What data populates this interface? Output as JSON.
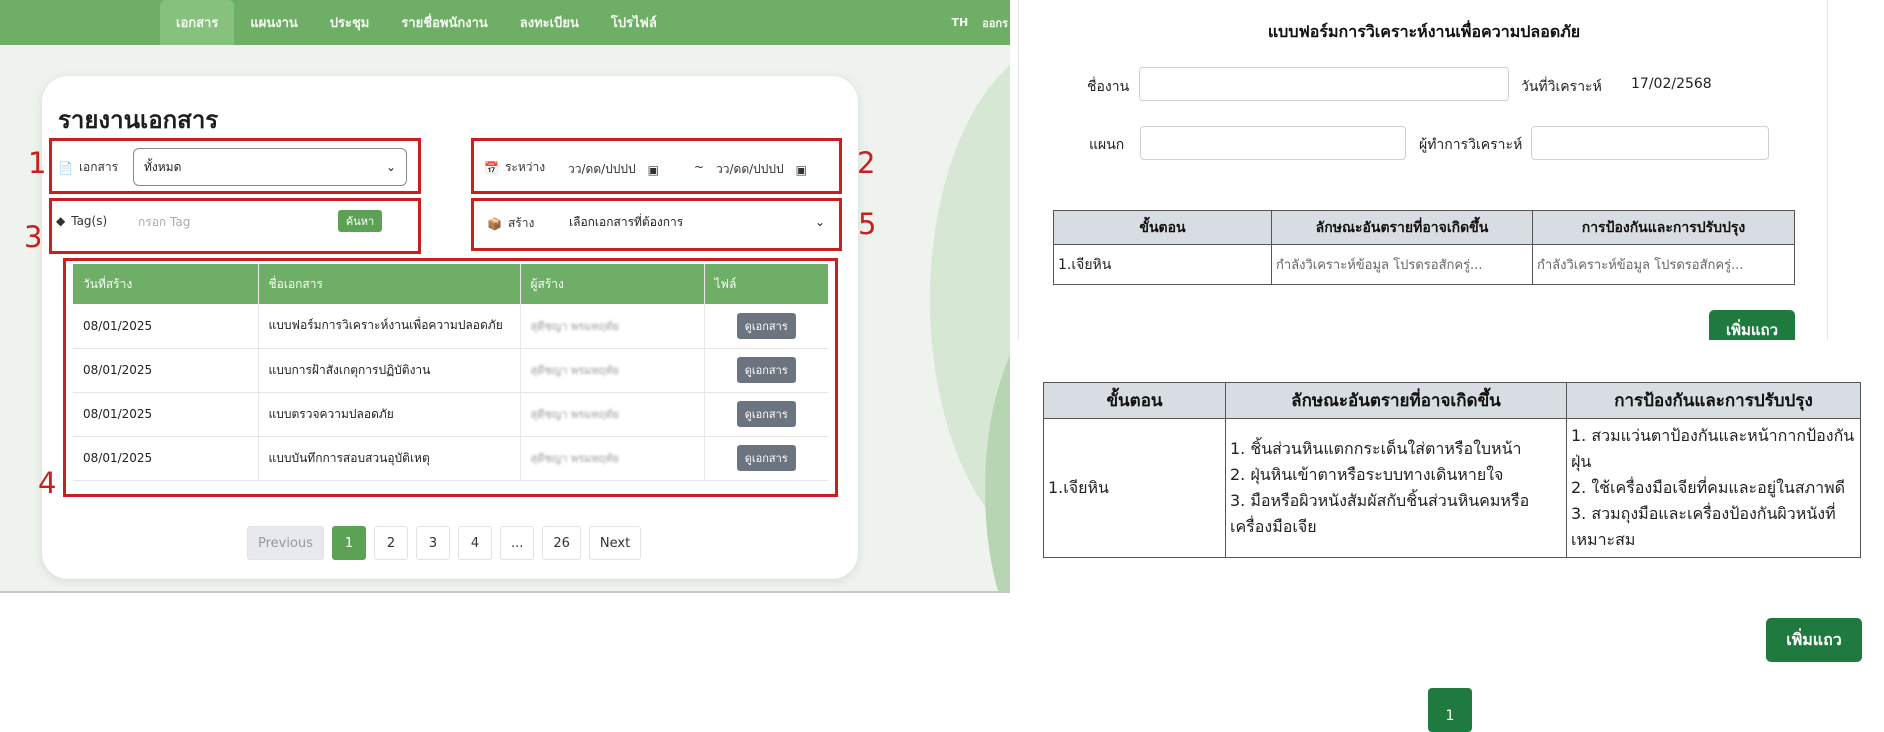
{
  "nav": {
    "tabs": [
      "เอกสาร",
      "แผนงาน",
      "ประชุม",
      "รายชื่อพนักงาน",
      "ลงทะเบียน",
      "โปรไฟล์"
    ],
    "lang": "TH",
    "logout": "ออกร"
  },
  "report": {
    "title": "รายงานเอกสาร",
    "doc_label": "เอกสาร",
    "doc_select": "ทั้งหมด",
    "tag_label": "Tag(s)",
    "tag_placeholder": "กรอก Tag",
    "search_label": "ค้นหา",
    "between_label": "ระหว่าง",
    "date_from": "วว/ดด/ปปปป",
    "date_sep": "~",
    "date_to": "วว/ดด/ปปปป",
    "create_label": "สร้าง",
    "create_select": "เลือกเอกสารที่ต้องการ",
    "annotations": [
      "1",
      "2",
      "3",
      "4",
      "5"
    ],
    "table": {
      "headers": [
        "วันที่สร้าง",
        "ชื่อเอกสาร",
        "ผู้สร้าง",
        "ไฟล์"
      ],
      "rows": [
        {
          "date": "08/01/2025",
          "name": "แบบฟอร์มการวิเคราะห์งานเพื่อความปลอดภัย",
          "creator": "สุดีชญา พรมหฤทัย",
          "file": "ดูเอกสาร"
        },
        {
          "date": "08/01/2025",
          "name": "แบบการฝ้าสังเกตุการปฏิบัติงาน",
          "creator": "สุดีชญา พรมหฤทัย",
          "file": "ดูเอกสาร"
        },
        {
          "date": "08/01/2025",
          "name": "แบบตรวจความปลอดภัย",
          "creator": "สุดีชญา พรมหฤทัย",
          "file": "ดูเอกสาร"
        },
        {
          "date": "08/01/2025",
          "name": "แบบบันทึกการสอบสวนอุบัติเหตุ",
          "creator": "สุดีชญา พรมหฤทัย",
          "file": "ดูเอกสาร"
        }
      ]
    },
    "pagination": [
      "Previous",
      "1",
      "2",
      "3",
      "4",
      "...",
      "26",
      "Next"
    ]
  },
  "form": {
    "title": "แบบฟอร์มการวิเคราะห์งานเพื่อความปลอดภัย",
    "job_label": "ชื่องาน",
    "date_label": "วันที่วิเคราะห์",
    "date_value": "17/02/2568",
    "dept_label": "แผนก",
    "analyst_label": "ผู้ทำการวิเคราะห์",
    "table_headers": [
      "ขั้นตอน",
      "ลักษณะอันตรายที่อาจเกิดขึ้น",
      "การป้องกันและการปรับปรุง"
    ],
    "row": {
      "step": "1.เจียหิน",
      "hazard": "กำลังวิเคราะห์ข้อมูล โปรดรอสักครู่...",
      "prevention": "กำลังวิเคราะห์ข้อมูล โปรดรอสักครู่..."
    },
    "add_row": "เพิ่มแถว"
  },
  "result": {
    "table_headers": [
      "ขั้นตอน",
      "ลักษณะอันตรายที่อาจเกิดขึ้น",
      "การป้องกันและการปรับปรุง"
    ],
    "step": "1.เจียหิน",
    "hazards": [
      "1. ชิ้นส่วนหินแตกกระเด็นใส่ตาหรือใบหน้า",
      "2. ฝุ่นหินเข้าตาหรือระบบทางเดินหายใจ",
      "3. มือหรือผิวหนังสัมผัสกับชิ้นส่วนหินคมหรือเครื่องมือเจีย"
    ],
    "preventions": [
      "1. สวมแว่นตาป้องกันและหน้ากากป้องกันฝุ่น",
      "2. ใช้เครื่องมือเจียที่คมและอยู่ในสภาพดี",
      "3. สวมถุงมือและเครื่องป้องกันผิวหนังที่เหมาะสม"
    ],
    "add_row": "เพิ่มแถว",
    "page": "1"
  },
  "colors": {
    "nav_green": "#6fae66",
    "highlight_red": "#c81f1f",
    "button_dark_green": "#1e7a3f"
  }
}
